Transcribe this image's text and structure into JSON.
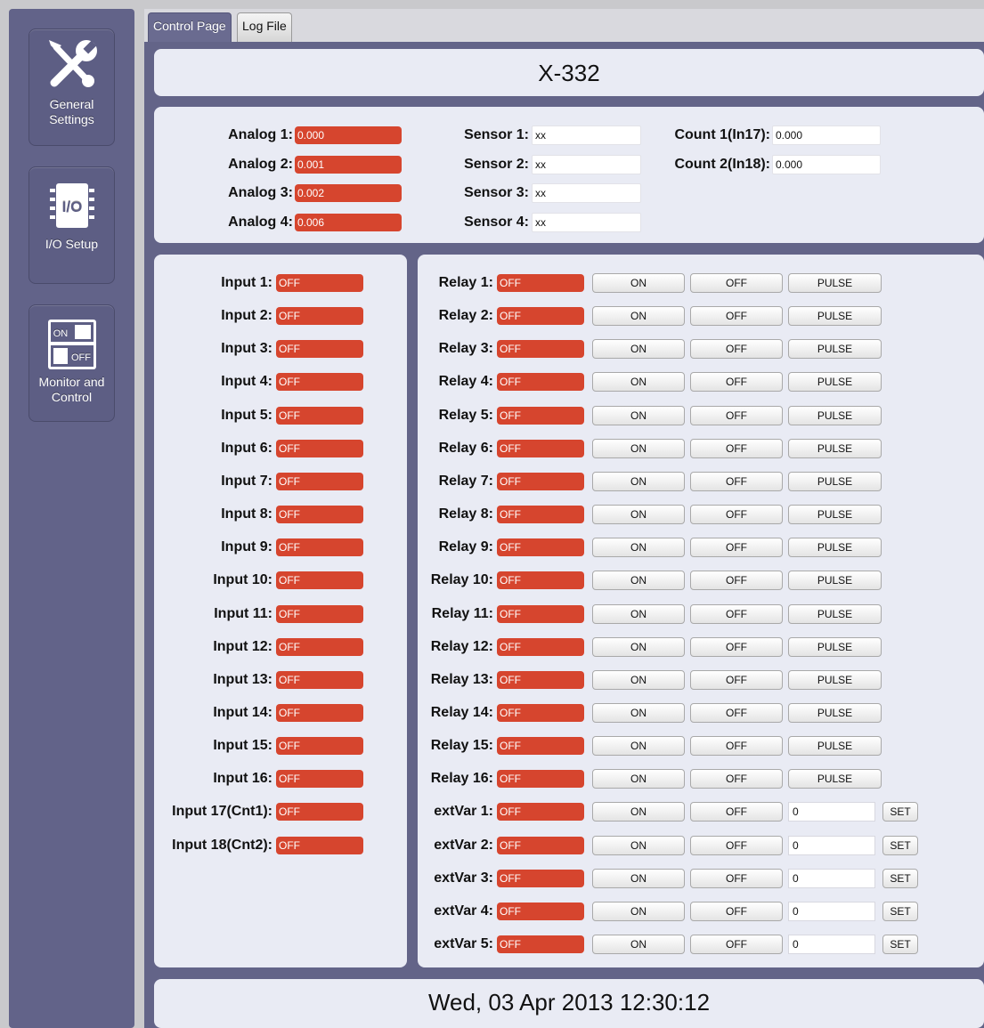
{
  "tabs": [
    {
      "label": "Control Page",
      "active": true
    },
    {
      "label": "Log File",
      "active": false
    }
  ],
  "sidebar": {
    "items": [
      {
        "label": "General\nSettings",
        "icon": "wrench-screwdriver-icon"
      },
      {
        "label": "I/O Setup",
        "icon": "io-chip-icon",
        "icon_text": "I/O"
      },
      {
        "label": "Monitor and\nControl",
        "icon": "on-off-switch-icon",
        "icon_on": "ON",
        "icon_off": "OFF"
      }
    ]
  },
  "device_name": "X-332",
  "analogs": [
    {
      "label": "Analog 1:",
      "value": "0.000"
    },
    {
      "label": "Analog 2:",
      "value": "0.001"
    },
    {
      "label": "Analog 3:",
      "value": "0.002"
    },
    {
      "label": "Analog 4:",
      "value": "0.006"
    }
  ],
  "sensors": [
    {
      "label": "Sensor 1:",
      "value": "xx"
    },
    {
      "label": "Sensor 2:",
      "value": "xx"
    },
    {
      "label": "Sensor 3:",
      "value": "xx"
    },
    {
      "label": "Sensor 4:",
      "value": "xx"
    }
  ],
  "counters": [
    {
      "label": "Count 1(In17):",
      "value": "0.000"
    },
    {
      "label": "Count 2(In18):",
      "value": "0.000"
    }
  ],
  "inputs": [
    {
      "label": "Input 1:",
      "state": "OFF"
    },
    {
      "label": "Input 2:",
      "state": "OFF"
    },
    {
      "label": "Input 3:",
      "state": "OFF"
    },
    {
      "label": "Input 4:",
      "state": "OFF"
    },
    {
      "label": "Input 5:",
      "state": "OFF"
    },
    {
      "label": "Input 6:",
      "state": "OFF"
    },
    {
      "label": "Input 7:",
      "state": "OFF"
    },
    {
      "label": "Input 8:",
      "state": "OFF"
    },
    {
      "label": "Input 9:",
      "state": "OFF"
    },
    {
      "label": "Input 10:",
      "state": "OFF"
    },
    {
      "label": "Input 11:",
      "state": "OFF"
    },
    {
      "label": "Input 12:",
      "state": "OFF"
    },
    {
      "label": "Input 13:",
      "state": "OFF"
    },
    {
      "label": "Input 14:",
      "state": "OFF"
    },
    {
      "label": "Input 15:",
      "state": "OFF"
    },
    {
      "label": "Input 16:",
      "state": "OFF"
    },
    {
      "label": "Input 17(Cnt1):",
      "state": "OFF"
    },
    {
      "label": "Input 18(Cnt2):",
      "state": "OFF"
    }
  ],
  "relays": [
    {
      "label": "Relay 1:",
      "state": "OFF"
    },
    {
      "label": "Relay 2:",
      "state": "OFF"
    },
    {
      "label": "Relay 3:",
      "state": "OFF"
    },
    {
      "label": "Relay 4:",
      "state": "OFF"
    },
    {
      "label": "Relay 5:",
      "state": "OFF"
    },
    {
      "label": "Relay 6:",
      "state": "OFF"
    },
    {
      "label": "Relay 7:",
      "state": "OFF"
    },
    {
      "label": "Relay 8:",
      "state": "OFF"
    },
    {
      "label": "Relay 9:",
      "state": "OFF"
    },
    {
      "label": "Relay 10:",
      "state": "OFF"
    },
    {
      "label": "Relay 11:",
      "state": "OFF"
    },
    {
      "label": "Relay 12:",
      "state": "OFF"
    },
    {
      "label": "Relay 13:",
      "state": "OFF"
    },
    {
      "label": "Relay 14:",
      "state": "OFF"
    },
    {
      "label": "Relay 15:",
      "state": "OFF"
    },
    {
      "label": "Relay 16:",
      "state": "OFF"
    }
  ],
  "ext_vars": [
    {
      "label": "extVar 1:",
      "state": "OFF",
      "value": "0"
    },
    {
      "label": "extVar 2:",
      "state": "OFF",
      "value": "0"
    },
    {
      "label": "extVar 3:",
      "state": "OFF",
      "value": "0"
    },
    {
      "label": "extVar 4:",
      "state": "OFF",
      "value": "0"
    },
    {
      "label": "extVar 5:",
      "state": "OFF",
      "value": "0"
    }
  ],
  "buttons": {
    "on": "ON",
    "off": "OFF",
    "pulse": "PULSE",
    "set": "SET"
  },
  "datetime": "Wed, 03 Apr 2013 12:30:12",
  "colors": {
    "status_off": "#d6452e",
    "sidebar": "#626389",
    "panel": "#e9ebf4"
  }
}
